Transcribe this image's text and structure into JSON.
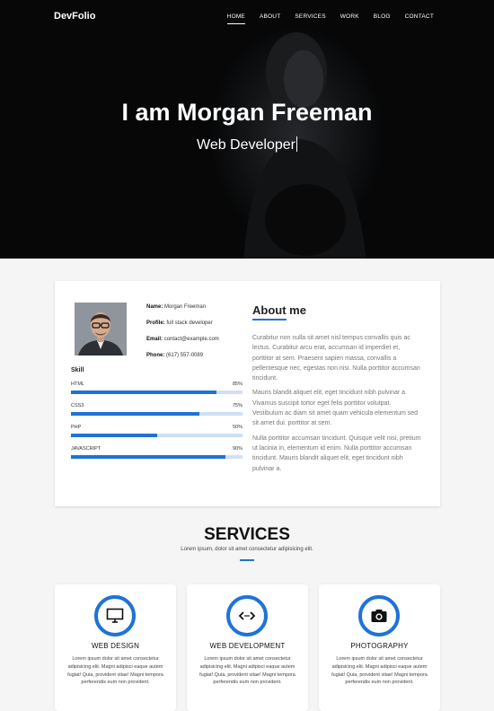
{
  "nav": {
    "brand": "DevFolio",
    "items": [
      {
        "label": "HOME",
        "active": true
      },
      {
        "label": "ABOUT"
      },
      {
        "label": "SERVICES"
      },
      {
        "label": "WORK"
      },
      {
        "label": "BLOG"
      },
      {
        "label": "CONTACT"
      }
    ]
  },
  "hero": {
    "title": "I am Morgan Freeman",
    "subtitle": "Web Developer"
  },
  "profile": {
    "name_label": "Name:",
    "name": "Morgan Freeman",
    "profile_label": "Profile:",
    "profile": "full stack developer",
    "email_label": "Email:",
    "email": "contact@example.com",
    "phone_label": "Phone:",
    "phone": "(617) 557-0089"
  },
  "skills": {
    "title": "Skill",
    "items": [
      {
        "name": "HTML",
        "percent_label": "85%",
        "percent": 85
      },
      {
        "name": "CSS3",
        "percent_label": "75%",
        "percent": 75
      },
      {
        "name": "PHP",
        "percent_label": "50%",
        "percent": 50
      },
      {
        "name": "JAVASCRIPT",
        "percent_label": "90%",
        "percent": 90
      }
    ]
  },
  "about": {
    "title": "About me",
    "paragraphs": [
      "Curabitur non nulla sit amet nisl tempus convallis quis ac lectus. Curabitur arcu erat, accumsan id imperdiet et, porttitor at sem. Praesent sapien massa, convallis a pellentesque nec, egestas non nisi. Nulla porttitor accumsan tincidunt.",
      "Mauris blandit aliquet elit, eget tincidunt nibh pulvinar a. Vivamus suscipit tortor eget felis porttitor volutpat. Vestibulum ac diam sit amet quam vehicula elementum sed sit amet dui. porttitor at sem.",
      "Nulla porttitor accumsan tincidunt. Quisque velit nisi, pretium ut lacinia in, elementum id enim. Nulla porttitor accumsan tincidunt. Mauris blandit aliquet elit, eget tincidunt nibh pulvinar a."
    ]
  },
  "services": {
    "title": "SERVICES",
    "subtitle": "Lorem ipsum, dolor sit amet consectetur adipisicing elit.",
    "items": [
      {
        "name": "WEB DESIGN",
        "icon": "monitor-icon",
        "desc": "Lorem ipsum dolor sit amet consectetur adipisicing elit. Magni adipisci eaque autem fugiat! Quia, provident vitae! Magni tempora perferendis eum non provident."
      },
      {
        "name": "WEB DEVELOPMENT",
        "icon": "code-icon",
        "desc": "Lorem ipsum dolor sit amet consectetur adipisicing elit. Magni adipisci eaque autem fugiat! Quia, provident vitae! Magni tempora perferendis eum non provident."
      },
      {
        "name": "PHOTOGRAPHY",
        "icon": "camera-icon",
        "desc": "Lorem ipsum dolor sit amet consectetur adipisicing elit. Magni adipisci eaque autem fugiat! Quia, provident vitae! Magni tempora perferendis eum non provident."
      }
    ]
  },
  "colors": {
    "accent": "#1e73d6",
    "hero_bg": "#0b0c0d",
    "page_bg": "#f5f5f5"
  }
}
